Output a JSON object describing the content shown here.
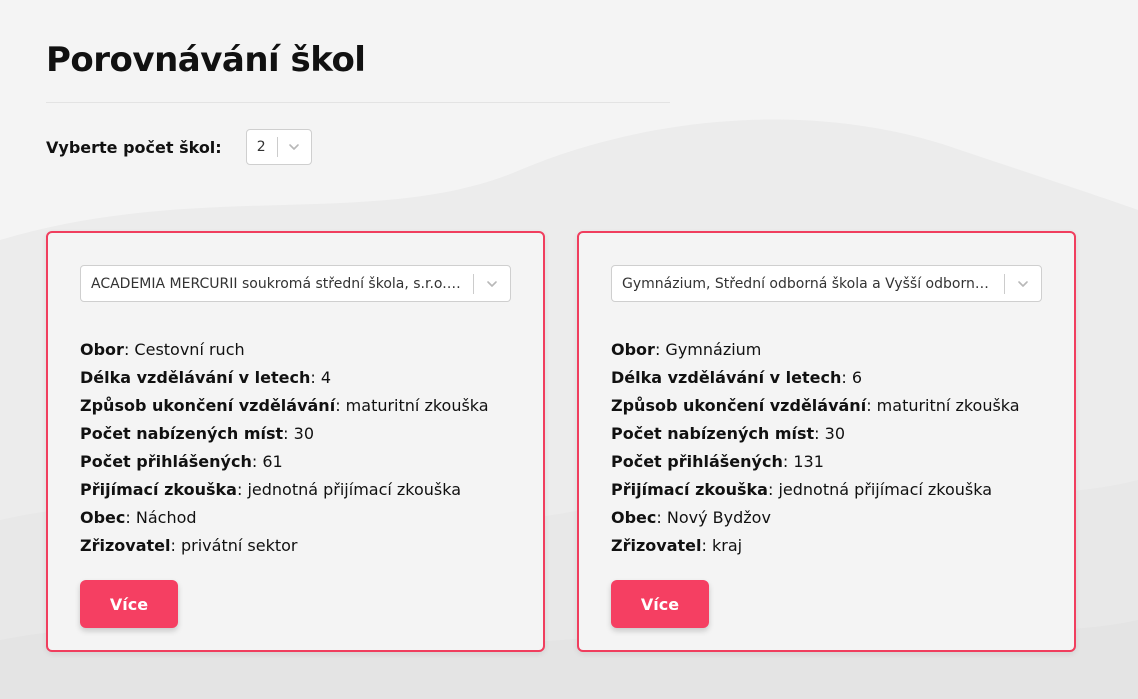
{
  "page": {
    "title": "Porovnávání škol"
  },
  "school_count": {
    "label": "Vyberte počet škol:",
    "value": "2"
  },
  "cards": [
    {
      "selected_school": "ACADEMIA MERCURII soukromá střední škola, s.r.o., Náchod",
      "fields": [
        {
          "label": "Obor",
          "value": "Cestovní ruch"
        },
        {
          "label": "Délka vzdělávání v letech",
          "value": "4"
        },
        {
          "label": "Způsob ukončení vzdělávání",
          "value": "maturitní zkouška"
        },
        {
          "label": "Počet nabízených míst",
          "value": "30"
        },
        {
          "label": "Počet přihlášených",
          "value": "61"
        },
        {
          "label": "Přijímací zkouška",
          "value": "jednotná přijímací zkouška"
        },
        {
          "label": "Obec",
          "value": "Náchod"
        },
        {
          "label": "Zřizovatel",
          "value": "privátní sektor"
        }
      ],
      "more_label": "Více"
    },
    {
      "selected_school": "Gymnázium, Střední odborná škola a Vyšší odborná škola, Nový Bydžov",
      "fields": [
        {
          "label": "Obor",
          "value": "Gymnázium"
        },
        {
          "label": "Délka vzdělávání v letech",
          "value": "6"
        },
        {
          "label": "Způsob ukončení vzdělávání",
          "value": "maturitní zkouška"
        },
        {
          "label": "Počet nabízených míst",
          "value": "30"
        },
        {
          "label": "Počet přihlášených",
          "value": "131"
        },
        {
          "label": "Přijímací zkouška",
          "value": "jednotná přijímací zkouška"
        },
        {
          "label": "Obec",
          "value": "Nový Bydžov"
        },
        {
          "label": "Zřizovatel",
          "value": "kraj"
        }
      ],
      "more_label": "Více"
    }
  ],
  "icons": {
    "dropdown": "chevron-down-icon"
  },
  "colors": {
    "accent": "#f53f62",
    "card_border": "#f03e5e",
    "background": "#f4f4f4"
  }
}
